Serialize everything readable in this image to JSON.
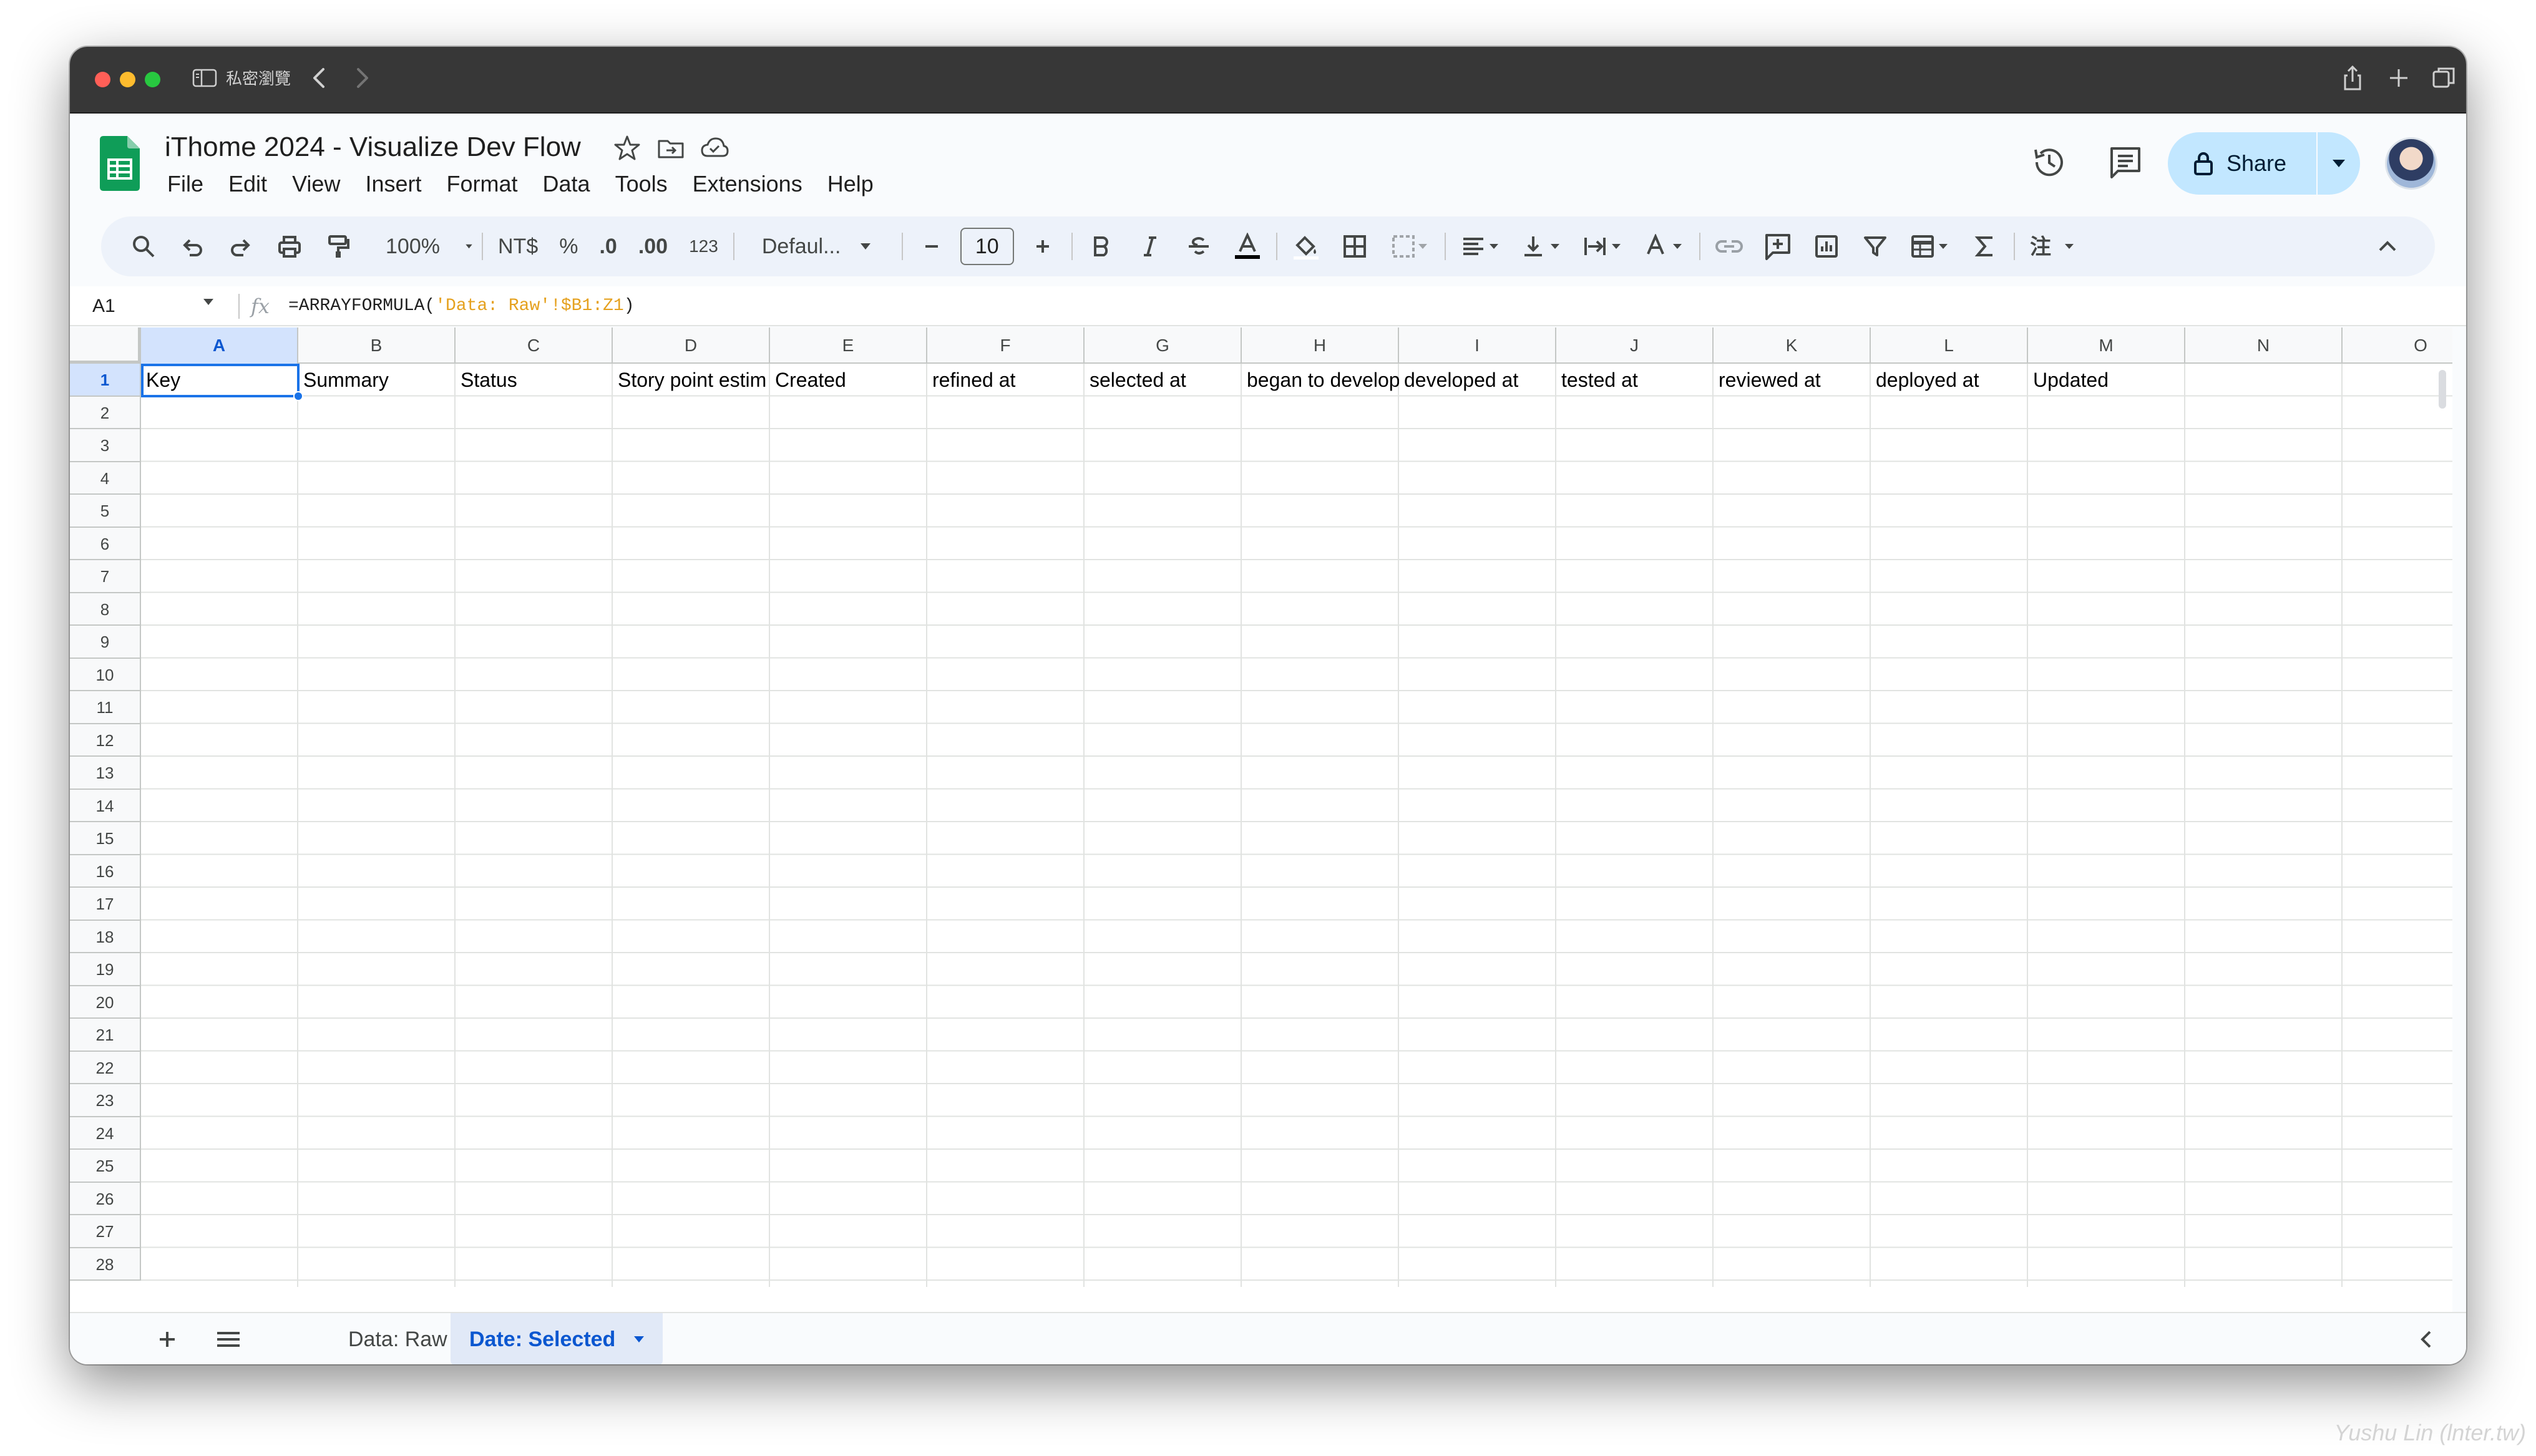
{
  "browser": {
    "private_label": "私密瀏覽"
  },
  "doc": {
    "title": "iThome 2024 - Visualize Dev Flow"
  },
  "menu": [
    "File",
    "Edit",
    "View",
    "Insert",
    "Format",
    "Data",
    "Tools",
    "Extensions",
    "Help"
  ],
  "header": {
    "share_label": "Share"
  },
  "toolbar": {
    "zoom": "100%",
    "currency": "NT$",
    "percent": "%",
    "decrease_decimal": ".0",
    "increase_decimal": ".00",
    "number_format": "123",
    "font": "Defaul...",
    "font_size": "10"
  },
  "formula_bar": {
    "cell_ref": "A1",
    "fx": "fx",
    "formula_prefix": "=ARRAYFORMULA(",
    "formula_string": "'Data: Raw'!$B1:Z1",
    "formula_suffix": ")"
  },
  "grid": {
    "columns": [
      "A",
      "B",
      "C",
      "D",
      "E",
      "F",
      "G",
      "H",
      "I",
      "J",
      "K",
      "L",
      "M",
      "N",
      "O"
    ],
    "selected_column": "A",
    "selected_row": "1",
    "rows": [
      "1",
      "2",
      "3",
      "4",
      "5",
      "6",
      "7",
      "8",
      "9",
      "10",
      "11",
      "12",
      "13",
      "14",
      "15",
      "16",
      "17",
      "18",
      "19",
      "20",
      "21",
      "22",
      "23",
      "24",
      "25",
      "26",
      "27",
      "28"
    ],
    "row1": [
      "Key",
      "Summary",
      "Status",
      "Story point estim",
      "Created",
      "refined at",
      "selected at",
      "began to develop",
      "developed at",
      "tested at",
      "reviewed at",
      "deployed at",
      "Updated",
      "",
      ""
    ]
  },
  "sheets": {
    "tabs": [
      {
        "label": "Data: Raw",
        "active": false
      },
      {
        "label": "Date: Selected",
        "active": true
      }
    ]
  },
  "watermark": "Yushu Lin (lnter.tw)",
  "colors": {
    "accent": "#1a73e8",
    "share_bg": "#c2e7ff",
    "selected_header_bg": "#d3e3fd",
    "sheets_green": "#0f9d58"
  }
}
